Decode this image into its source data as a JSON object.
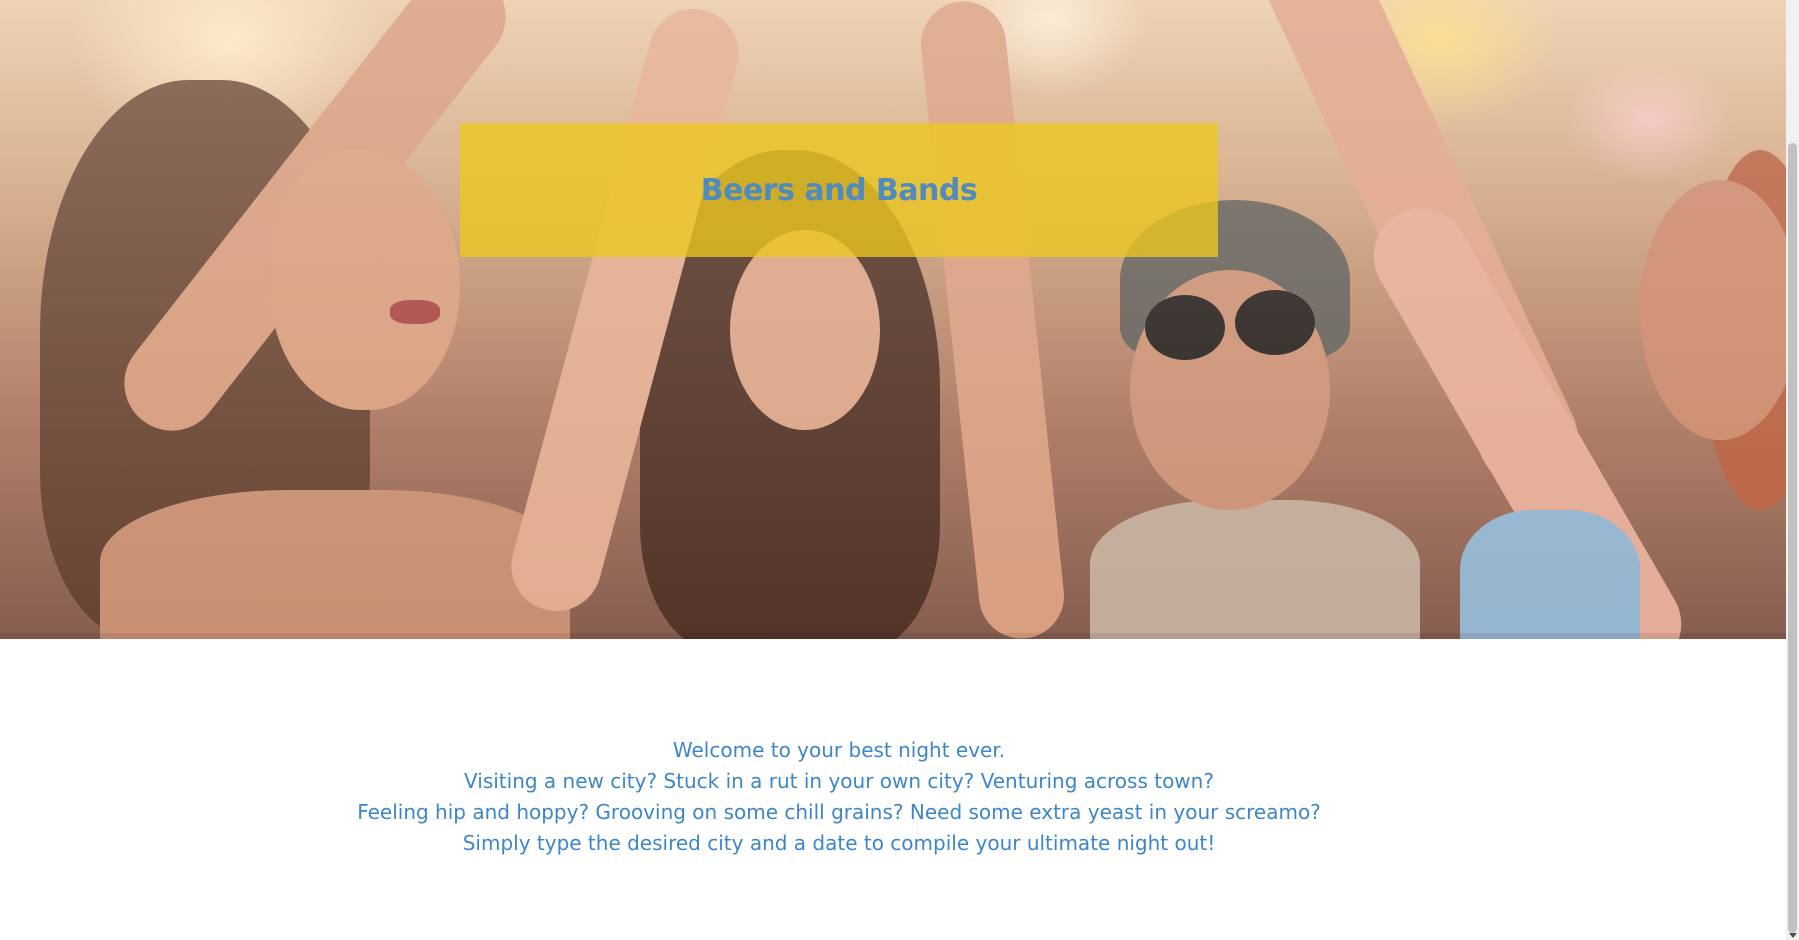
{
  "hero": {
    "image_alt": "Friends raising hands together at a music festival",
    "title": "Beers and Bands"
  },
  "intro": {
    "lines": [
      "Welcome to your best night ever.",
      "Visiting a new city? Stuck in a rut in your own city? Venturing across town?",
      "Feeling hip and hoppy? Grooving on some chill grains? Need some extra yeast in your screamo?",
      "Simply type the desired city and a date to compile your ultimate night out!"
    ]
  },
  "colors": {
    "banner_bg": "#ECC81E",
    "title_text": "#4F8BBF",
    "body_text": "#3D86C9"
  },
  "scrollbar": {
    "arrow_icon": "chevron-down-icon"
  }
}
